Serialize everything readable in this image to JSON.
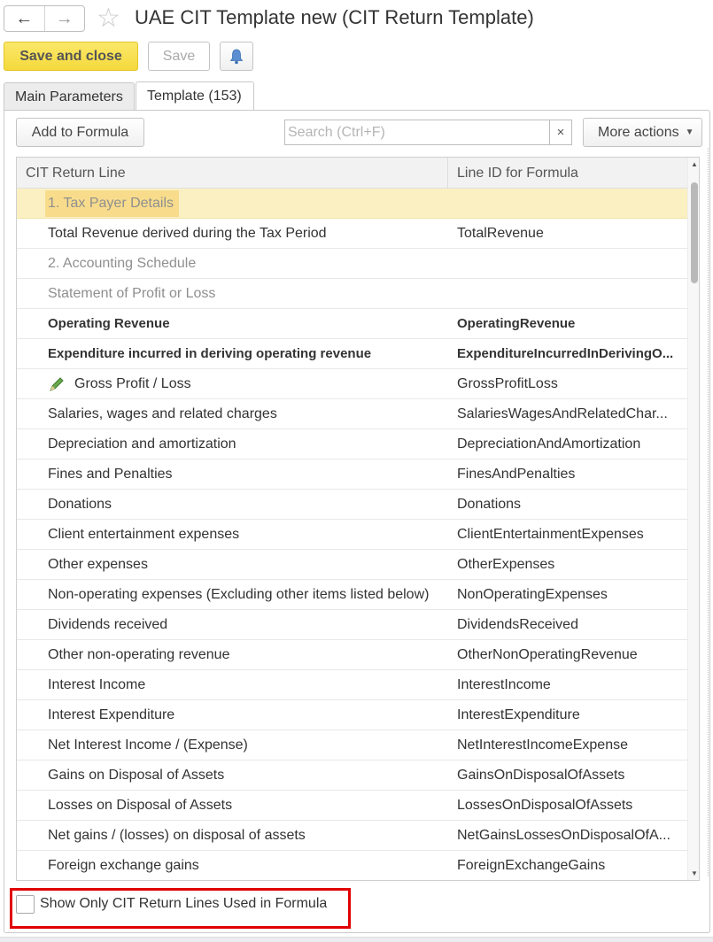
{
  "window": {
    "title": "UAE CIT Template new (CIT Return Template)",
    "back_icon": "←",
    "forward_icon": "→",
    "star_icon": "☆"
  },
  "toolbar": {
    "save_close_label": "Save and close",
    "save_label": "Save",
    "bell_icon": "bell-icon"
  },
  "tabs": [
    {
      "label": "Main Parameters"
    },
    {
      "label": "Template (153)"
    }
  ],
  "actions": {
    "add_label": "Add to Formula",
    "search_placeholder": "Search (Ctrl+F)",
    "search_value": "",
    "clear_icon": "×",
    "more_label": "More actions",
    "more_caret": "▼"
  },
  "table": {
    "columns": [
      "CIT Return Line",
      "Line ID for Formula"
    ],
    "rows": [
      {
        "line": "1. Tax Payer Details",
        "id": ""
      },
      {
        "line": "Total Revenue derived during the Tax Period",
        "id": "TotalRevenue"
      },
      {
        "line": "2. Accounting Schedule",
        "id": ""
      },
      {
        "line": "Statement of Profit or Loss",
        "id": ""
      },
      {
        "line": "Operating Revenue",
        "id": "OperatingRevenue"
      },
      {
        "line": "Expenditure incurred in deriving operating revenue",
        "id": "ExpenditureIncurredInDerivingO..."
      },
      {
        "line": "Gross Profit / Loss",
        "id": "GrossProfitLoss"
      },
      {
        "line": "Salaries, wages and related charges",
        "id": "SalariesWagesAndRelatedChar..."
      },
      {
        "line": "Depreciation and amortization",
        "id": "DepreciationAndAmortization"
      },
      {
        "line": "Fines and Penalties",
        "id": "FinesAndPenalties"
      },
      {
        "line": "Donations",
        "id": "Donations"
      },
      {
        "line": "Client entertainment expenses",
        "id": "ClientEntertainmentExpenses"
      },
      {
        "line": "Other expenses",
        "id": "OtherExpenses"
      },
      {
        "line": "Non-operating expenses (Excluding other items listed below)",
        "id": "NonOperatingExpenses"
      },
      {
        "line": "Dividends received",
        "id": "DividendsReceived"
      },
      {
        "line": "Other non-operating revenue",
        "id": "OtherNonOperatingRevenue"
      },
      {
        "line": "Interest Income",
        "id": "InterestIncome"
      },
      {
        "line": "Interest Expenditure",
        "id": "InterestExpenditure"
      },
      {
        "line": "Net Interest Income / (Expense)",
        "id": "NetInterestIncomeExpense"
      },
      {
        "line": "Gains on Disposal of Assets",
        "id": "GainsOnDisposalOfAssets"
      },
      {
        "line": "Losses on Disposal of Assets",
        "id": "LossesOnDisposalOfAssets"
      },
      {
        "line": "Net gains / (losses) on disposal of assets",
        "id": "NetGainsLossesOnDisposalOfA..."
      },
      {
        "line": "Foreign exchange gains",
        "id": "ForeignExchangeGains"
      }
    ]
  },
  "footer": {
    "checkbox_label": "Show Only CIT Return Lines Used in Formula",
    "checked": false
  },
  "colors": {
    "primary_button": "#f5d93c",
    "selected_row": "#fbf0c2",
    "highlight": "#f8dc8c",
    "annotation_box": "#e00000"
  }
}
